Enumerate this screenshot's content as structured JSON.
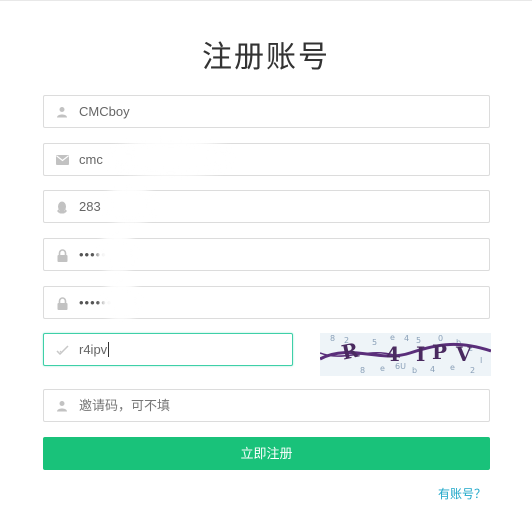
{
  "page": {
    "title": "注册账号"
  },
  "form": {
    "username": {
      "value": "CMCboy",
      "icon": "user-icon"
    },
    "email": {
      "value": "cmc",
      "icon": "mail-icon"
    },
    "qq": {
      "value": "283",
      "icon": "qq-penguin-icon"
    },
    "password": {
      "value": "•••••",
      "icon": "lock-icon"
    },
    "confirm_password": {
      "value": "••••••",
      "icon": "lock-icon"
    },
    "captcha": {
      "value": "r4ipv",
      "icon": "check-icon",
      "image_text": "R4IPV"
    },
    "invite_code": {
      "placeholder": "邀请码，可不填",
      "icon": "user-icon"
    }
  },
  "actions": {
    "register_label": "立即注册",
    "login_link": "有账号？"
  },
  "colors": {
    "primary": "#19c27a",
    "focus_border": "#3ed0a8",
    "link": "#1ea7c9"
  }
}
